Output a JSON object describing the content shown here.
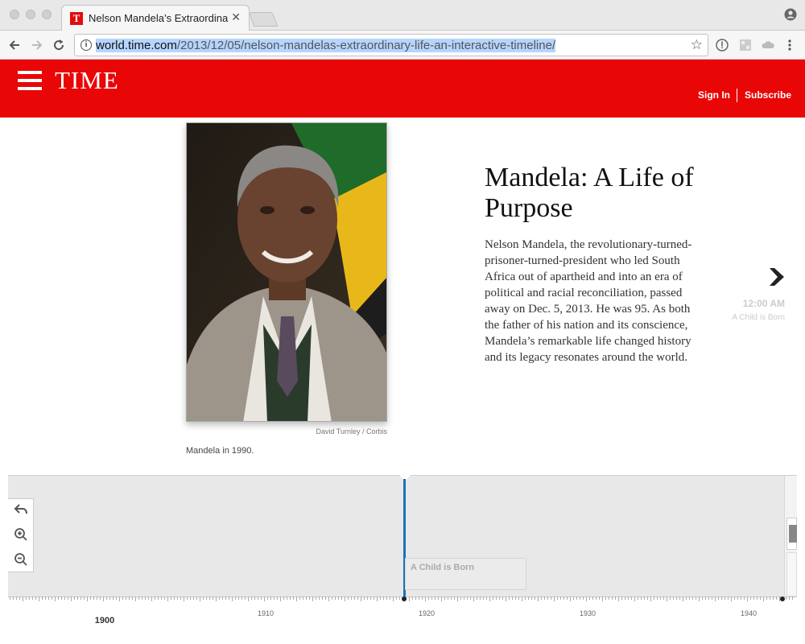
{
  "browser": {
    "tab_title": "Nelson Mandela’s Extraordinar",
    "tab_close": "✕",
    "url_host": "world.time.com",
    "url_path": "/2013/12/05/nelson-mandelas-extraordinary-life-an-interactive-timeline/",
    "star": "☆"
  },
  "header": {
    "logo": "TIME",
    "sign_in": "Sign In",
    "subscribe": "Subscribe",
    "brand_color": "#e90606"
  },
  "article": {
    "photo_credit": "David Turnley / Corbis",
    "photo_caption": "Mandela in 1990.",
    "headline": "Mandela: A Life of Purpose",
    "body": "Nelson Mandela, the revolutionary-turned-prisoner-turned-president who led South Africa out of apartheid and into an era of political and racial reconciliation, passed away on Dec. 5, 2013. He was 95. As both the father of his nation and its conscience, Mandela’s remarkable life changed history and its legacy resonates around the world."
  },
  "side_nav": {
    "time": "12:00 AM",
    "label": "A Child is Born"
  },
  "timeline": {
    "event_title": "A Child is Born",
    "current_marker_color": "#1a73b8",
    "major_year": "1900",
    "years": [
      "1910",
      "1920",
      "1930",
      "1940"
    ]
  }
}
